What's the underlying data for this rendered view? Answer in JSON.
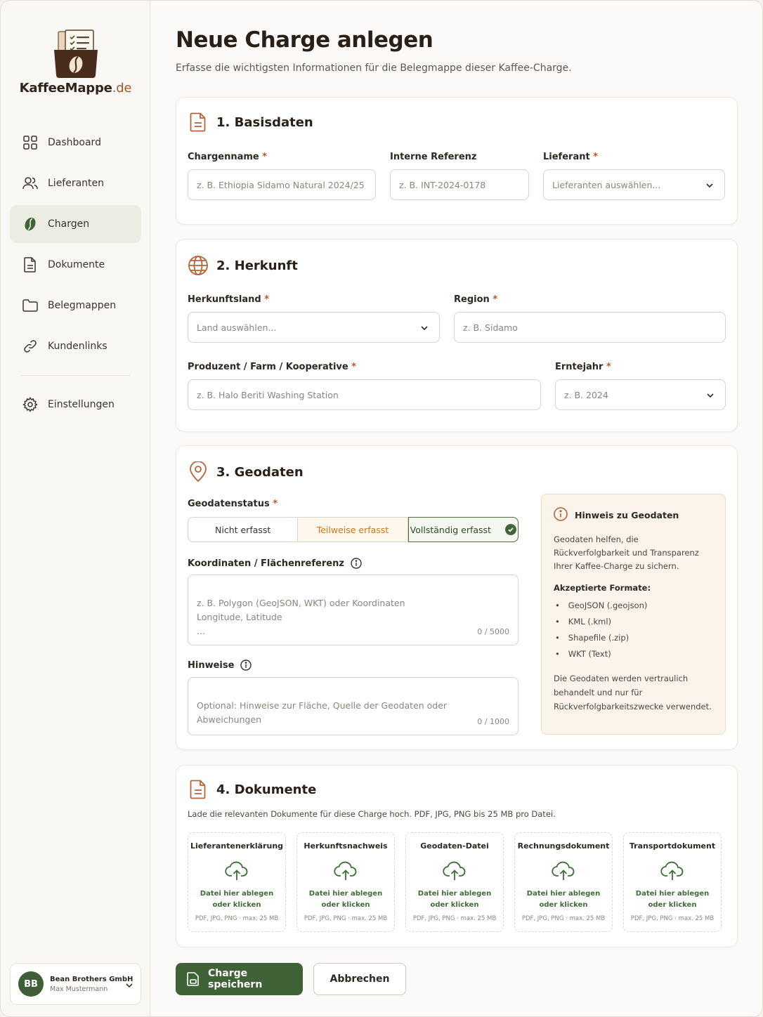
{
  "brand": {
    "name": "KaffeeMappe",
    "tld": ".de"
  },
  "sidebar": {
    "items": [
      {
        "label": "Dashboard",
        "icon": "grid-icon"
      },
      {
        "label": "Lieferanten",
        "icon": "users-icon"
      },
      {
        "label": "Chargen",
        "icon": "coffee-bean-icon",
        "active": true
      },
      {
        "label": "Dokumente",
        "icon": "document-icon"
      },
      {
        "label": "Belegmappen",
        "icon": "folder-icon"
      },
      {
        "label": "Kundenlinks",
        "icon": "link-icon"
      }
    ],
    "settings": {
      "label": "Einstellungen",
      "icon": "gear-icon"
    },
    "user": {
      "initials": "BB",
      "company": "Bean Brothers GmbH",
      "name": "Max Mustermann"
    }
  },
  "page": {
    "title": "Neue Charge anlegen",
    "subtitle": "Erfasse die wichtigsten Informationen für die Belegmappe dieser Kaffee-Charge."
  },
  "basisdaten": {
    "title": "1. Basisdaten",
    "chargenname": {
      "label": "Chargenname",
      "placeholder": "z. B. Ethiopia Sidamo Natural 2024/25"
    },
    "referenz": {
      "label": "Interne Referenz",
      "placeholder": "z. B. INT-2024-0178"
    },
    "lieferant": {
      "label": "Lieferant",
      "placeholder": "Lieferanten auswählen..."
    }
  },
  "herkunft": {
    "title": "2. Herkunft",
    "land": {
      "label": "Herkunftsland",
      "placeholder": "Land auswählen..."
    },
    "region": {
      "label": "Region",
      "placeholder": "z. B. Sidamo"
    },
    "produzent": {
      "label": "Produzent / Farm / Kooperative",
      "placeholder": "z. B. Halo Beriti Washing Station"
    },
    "erntejahr": {
      "label": "Erntejahr",
      "placeholder": "z. B. 2024"
    }
  },
  "geodaten": {
    "title": "3. Geodaten",
    "status_label": "Geodatenstatus",
    "status_options": [
      "Nicht erfasst",
      "Teilweise erfasst",
      "Vollständig erfasst"
    ],
    "status_selected": "Vollständig erfasst",
    "koordinaten": {
      "label": "Koordinaten / Flächenreferenz",
      "placeholder": "z. B. Polygon (GeoJSON, WKT) oder Koordinaten\nLongitude, Latitude\n...",
      "counter": "0 / 5000"
    },
    "hinweise": {
      "label": "Hinweise",
      "placeholder": "Optional: Hinweise zur Fläche, Quelle der Geodaten oder Abweichungen",
      "counter": "0 / 1000"
    },
    "hint": {
      "title": "Hinweis zu Geodaten",
      "text": "Geodaten helfen, die Rückverfolgbarkeit und Transparenz Ihrer Kaffee-Charge zu sichern.",
      "formats_title": "Akzeptierte Formate:",
      "formats": [
        "GeoJSON (.geojson)",
        "KML (.kml)",
        "Shapefile (.zip)",
        "WKT (Text)"
      ],
      "footer": "Die Geodaten werden vertraulich behandelt und nur für Rückverfolgbarkeitszwecke verwendet."
    }
  },
  "dokumente": {
    "title": "4. Dokumente",
    "description": "Lade die relevanten Dokumente für diese Charge hoch. PDF, JPG, PNG bis 25 MB pro Datei.",
    "dropzones": [
      {
        "title": "Lieferantenerklärung",
        "action_1": "Datei hier ablegen",
        "action_2": "oder klicken",
        "meta": "PDF, JPG, PNG · max. 25 MB"
      },
      {
        "title": "Herkunftsnachweis",
        "action_1": "Datei hier ablegen",
        "action_2": "oder klicken",
        "meta": "PDF, JPG, PNG · max. 25 MB"
      },
      {
        "title": "Geodaten-Datei",
        "action_1": "Datei hier ablegen",
        "action_2": "oder klicken",
        "meta": "PDF, JPG, PNG · max. 25 MB"
      },
      {
        "title": "Rechnungsdokument",
        "action_1": "Datei hier ablegen",
        "action_2": "oder klicken",
        "meta": "PDF, JPG, PNG · max. 25 MB"
      },
      {
        "title": "Transportdokument",
        "action_1": "Datei hier ablegen",
        "action_2": "oder klicken",
        "meta": "PDF, JPG, PNG · max. 25 MB"
      }
    ]
  },
  "actions": {
    "save": "Charge speichern",
    "cancel": "Abbrechen"
  },
  "colors": {
    "primary_green": "#3f6337",
    "accent_orange": "#a4572d",
    "hint_bg": "#fcf4ea"
  }
}
